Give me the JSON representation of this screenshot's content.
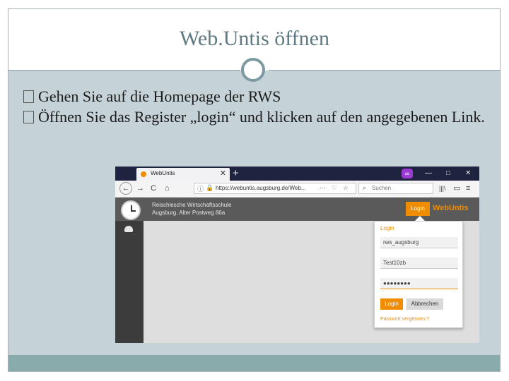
{
  "slide": {
    "title": "Web.Untis öffnen",
    "bullets": [
      "Gehen Sie auf die Homepage der RWS",
      "Öffnen Sie das Register „login“ und klicken auf den angegebenen Link."
    ]
  },
  "browser": {
    "tab_title": "WebUntis",
    "tab_close": "✕",
    "new_tab": "+",
    "window_controls": [
      "—",
      "□",
      "✕"
    ],
    "private_badge": "∞",
    "nav": {
      "back": "←",
      "forward": "→",
      "reload": "C",
      "home": "⌂"
    },
    "url": "https://webuntis.augsburg.de/Web...",
    "url_actions": [
      "···",
      "♡",
      "☆"
    ],
    "search_placeholder": "Suchen",
    "toolbar_right": [
      "|||\\",
      "▭",
      "≡"
    ]
  },
  "webuntis": {
    "school_line1": "Reischlesche Wirtschaftsschule",
    "school_line2": "Augsburg, Alter Postweg 86a",
    "header_login": "Login",
    "brand": "WebUntis",
    "login_panel": {
      "title": "Login",
      "school_value": "rws_augsburg",
      "username_value": "Test10zb",
      "password_value": "●●●●●●●●",
      "login_button": "Login",
      "cancel_button": "Abbrechen",
      "forgot_link": "Passwort vergessen ?"
    }
  },
  "colors": {
    "slide_background": "#c5d2d8",
    "title_color": "#5f7a82",
    "accent": "#f08c00",
    "footer_bar": "#8aabab"
  }
}
